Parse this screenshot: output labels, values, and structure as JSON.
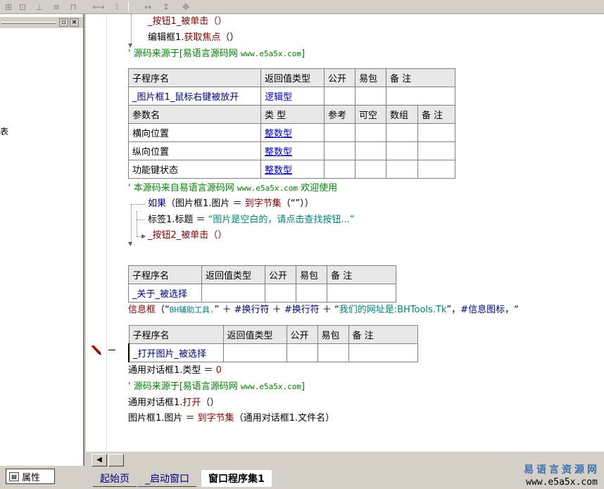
{
  "toolbar": {
    "buttons": [
      "align-left-icon",
      "align-top-icon",
      "align-center-icon",
      "align-bottom-icon",
      "space-horizontal-icon",
      "space-vertical-icon",
      "width-icon",
      "height-icon",
      "size-both-icon"
    ]
  },
  "left_panel": {
    "partial_text": "表",
    "property_tab_label": "属性"
  },
  "code": {
    "line1": "_按钮1_被单击（）",
    "line2_obj": "编辑框1.",
    "line2_method": "获取焦点",
    "line2_tail": "（）",
    "comment1_prefix": "' 源码来源于[易语言源码网 ",
    "comment1_url": "www.e5a5x.com",
    "comment1_suffix": "]",
    "table1": {
      "headers": [
        "子程序名",
        "返回值类型",
        "公开",
        "易包",
        "备 注"
      ],
      "row": [
        "_图片框1_鼠标右键被放开",
        "逻辑型",
        "",
        "",
        ""
      ],
      "param_headers": [
        "参数名",
        "类 型",
        "参考",
        "可空",
        "数组",
        "备 注"
      ],
      "params": [
        [
          "横向位置",
          "整数型"
        ],
        [
          "纵向位置",
          "整数型"
        ],
        [
          "功能键状态",
          "整数型"
        ]
      ]
    },
    "comment2_prefix": "' 本源码来自易语言源码网 ",
    "comment2_url": "www.e5a5x.com",
    "comment2_suffix": "  欢迎使用",
    "if_kw": "如果",
    "if_body_1": "（图片框1.图片 ＝ ",
    "if_func": "到字节集",
    "if_body_2": "（“”））",
    "label_obj": "标签1.标题 ＝ ",
    "label_str": "“图片是空白的，请点击查找按钮...”",
    "call_btn2": "_按钮2_被单击（）",
    "table2": {
      "headers": [
        "子程序名",
        "返回值类型",
        "公开",
        "易包",
        "备 注"
      ],
      "row": [
        "_关于_被选择",
        "",
        "",
        "",
        ""
      ]
    },
    "msgbox_fn": "信息框",
    "msgbox_p1": "（“",
    "msgbox_s1": "BH辅助工具.",
    "msgbox_p2": "” ＋ ",
    "msgbox_k1": "#换行符",
    "msgbox_p3": " ＋ ",
    "msgbox_k2": "#换行符",
    "msgbox_p4": " ＋ “",
    "msgbox_s2": "我们的网址是:BHTools.Tk",
    "msgbox_p5": "”，",
    "msgbox_k3": "#信息图标",
    "msgbox_p6": "，“",
    "table3": {
      "headers": [
        "子程序名",
        "返回值类型",
        "公开",
        "易包",
        "备 注"
      ],
      "row": [
        "_打开图片_被选择",
        "",
        "",
        "",
        ""
      ]
    },
    "dialog_type_obj": "通用对话框1.类型 ＝ ",
    "dialog_type_val": "0",
    "comment3_prefix": "' 源码来源于[易语言源码网 ",
    "comment3_url": "www.e5a5x.com",
    "comment3_suffix": "]",
    "dialog_open_obj": "通用对话框1.",
    "dialog_open_method": "打开",
    "dialog_open_tail": "（）",
    "pic_assign_obj": "图片框1.图片 ＝ ",
    "pic_assign_func": "到字节集",
    "pic_assign_tail": "（通用对话框1.文件名）"
  },
  "tabs": [
    "起始页",
    "_启动窗口",
    "窗口程序集1"
  ],
  "watermark": {
    "title": "易语言资源网",
    "url": "www.e5a5x.com"
  },
  "colors": {
    "comment": "#008000",
    "keyword": "#800000",
    "string": "#008080",
    "type": "#0000c0"
  }
}
